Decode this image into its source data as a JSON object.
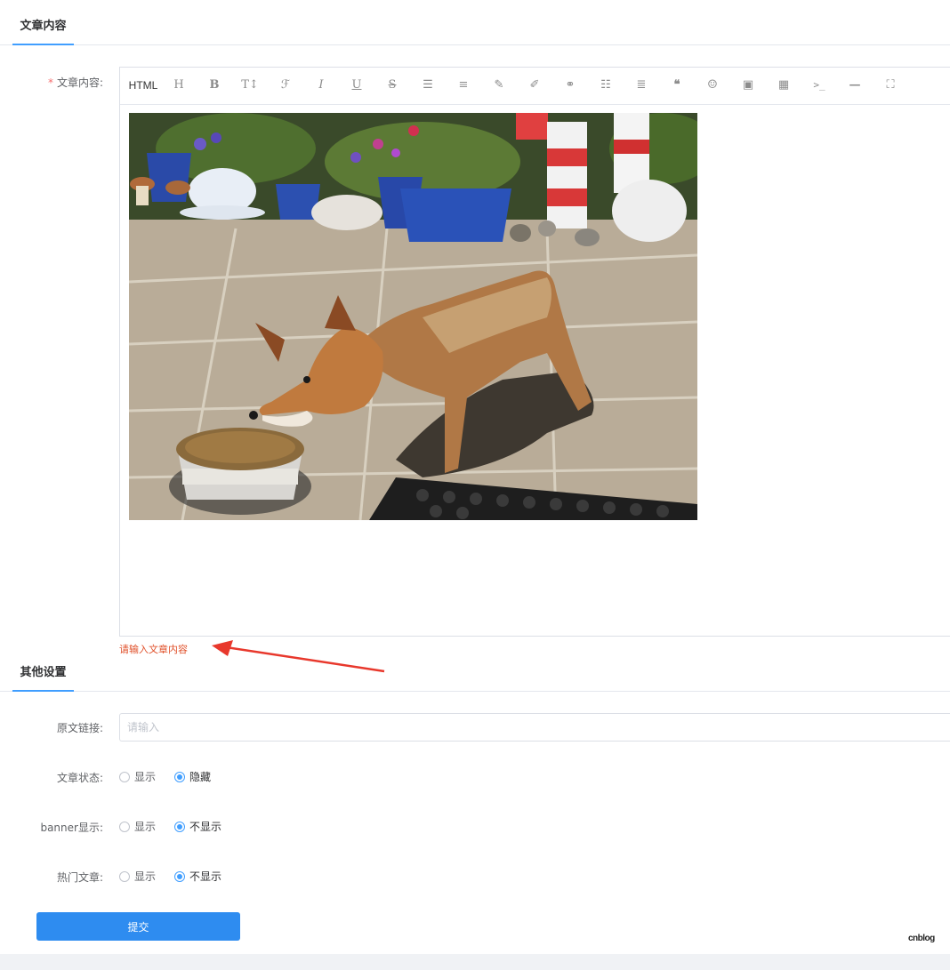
{
  "sections": {
    "content_tab": "文章内容",
    "other_tab": "其他设置"
  },
  "content_field": {
    "required_mark": "*",
    "label": "文章内容:",
    "error": "请输入文章内容"
  },
  "toolbar": {
    "html_label": "HTML",
    "icons": [
      "heading-icon",
      "bold-icon",
      "font-size-icon",
      "font-family-icon",
      "italic-icon",
      "underline-icon",
      "strikethrough-icon",
      "indent-icon",
      "line-height-icon",
      "highlight-icon",
      "brush-icon",
      "link-icon",
      "list-icon",
      "align-icon",
      "quote-icon",
      "emoji-icon",
      "image-icon",
      "video-icon",
      "code-icon",
      "divider-icon",
      "fullscreen-icon"
    ],
    "glyphs": {
      "heading": "H",
      "bold": "B",
      "font_size": "T↕",
      "font_family": "ℱ",
      "italic": "I",
      "underline": "U",
      "strikethrough": "S",
      "indent": "☰",
      "line_height": "≡",
      "highlight": "✎",
      "brush": "✐",
      "link": "⚭",
      "list": "☷",
      "align": "≣",
      "quote": "❝",
      "emoji": "☺",
      "image": "▣",
      "video": "▦",
      "code": ">_",
      "divider": "—",
      "fullscreen": "⛶"
    }
  },
  "link_field": {
    "label": "原文链接:",
    "placeholder": "请输入",
    "value": ""
  },
  "status_field": {
    "label": "文章状态:",
    "options": [
      "显示",
      "隐藏"
    ],
    "selected": "隐藏"
  },
  "banner_field": {
    "label": "banner显示:",
    "options": [
      "显示",
      "不显示"
    ],
    "selected": "不显示"
  },
  "hot_field": {
    "label": "热门文章:",
    "options": [
      "显示",
      "不显示"
    ],
    "selected": "不显示"
  },
  "submit_label": "提交",
  "colors": {
    "primary": "#409eff",
    "button": "#2e8cf0",
    "error": "#e0502a",
    "arrow": "#e8382c"
  },
  "watermark": "cnblog"
}
